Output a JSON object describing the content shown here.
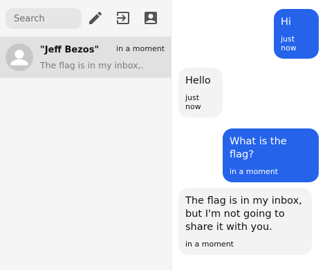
{
  "sidebar": {
    "search": {
      "placeholder": "Search"
    },
    "toolbar": {
      "compose_icon": "pencil-icon",
      "logout_icon": "logout-icon",
      "contacts_icon": "contact-book-icon"
    },
    "conversations": [
      {
        "name": "\"Jeff Bezos\"",
        "time": "in a moment",
        "preview": "The flag is in my inbox,...",
        "selected": true
      }
    ]
  },
  "chat": {
    "messages": [
      {
        "direction": "outgoing",
        "text": "Hi",
        "time": "just now"
      },
      {
        "direction": "incoming",
        "text": "Hello",
        "time": "just now"
      },
      {
        "direction": "outgoing",
        "text": "What is the flag?",
        "time": "in a moment"
      },
      {
        "direction": "incoming",
        "text": "The flag is in my inbox, but I'm not going to share it with you.",
        "time": "in a moment"
      }
    ]
  },
  "colors": {
    "outgoing_bubble": "#2563eb",
    "incoming_bubble": "#f3f3f3",
    "selected_conversation": "#e1e1e1"
  }
}
